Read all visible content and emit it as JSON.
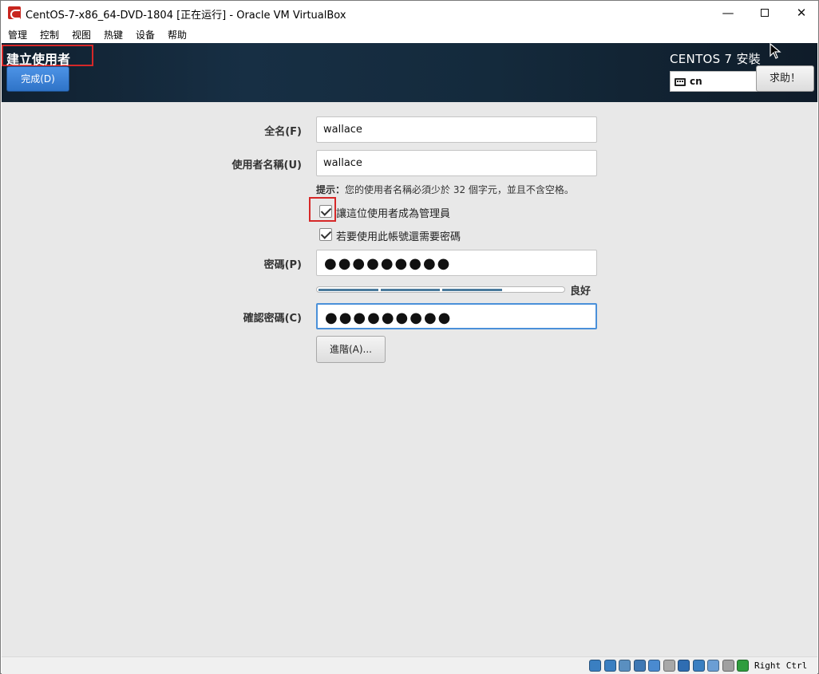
{
  "window": {
    "title": "CentOS-7-x86_64-DVD-1804 [正在运行] - Oracle VM VirtualBox",
    "minimize_glyph": "—",
    "close_glyph": "✕"
  },
  "menubar": {
    "items": [
      "管理",
      "控制",
      "视图",
      "热键",
      "设备",
      "帮助"
    ]
  },
  "header": {
    "page_title": "建立使用者",
    "done_label": "完成(D)",
    "install_title": "CENTOS 7 安裝",
    "keyboard_layout": "cn",
    "help_label": "求助！"
  },
  "form": {
    "fullname_label": "全名(F)",
    "fullname_value": "wallace",
    "username_label": "使用者名稱(U)",
    "username_value": "wallace",
    "hint_prefix": "提示：",
    "hint_text": "您的使用者名稱必須少於 32 個字元，並且不含空格。",
    "admin_checkbox_label": "讓這位使用者成為管理員",
    "admin_checked": true,
    "require_password_label": "若要使用此帳號還需要密碼",
    "require_password_checked": true,
    "password_label": "密碼(P)",
    "password_value": "●●●●●●●●●",
    "strength": 0.75,
    "strength_label": "良好",
    "confirm_label": "確認密碼(C)",
    "confirm_value": "●●●●●●●●●",
    "advanced_label": "進階(A)..."
  },
  "statusbar": {
    "host_key": "Right Ctrl",
    "icons": [
      "hard-disk-icon",
      "optical-drive-icon",
      "audio-icon",
      "network-icon",
      "usb-icon",
      "shared-folders-icon",
      "display-icon",
      "video-capture-icon",
      "cpu-icon",
      "mouse-integration-icon",
      "keyboard-capture-icon"
    ],
    "icon_colors": [
      "#3a7fc1",
      "#3a7fc1",
      "#5a8fc0",
      "#3f78b4",
      "#4a8ad0",
      "#a8a8a8",
      "#2f6db2",
      "#3a7fc1",
      "#6b9ed4",
      "#a0a0a0",
      "#2f9d3e"
    ]
  }
}
